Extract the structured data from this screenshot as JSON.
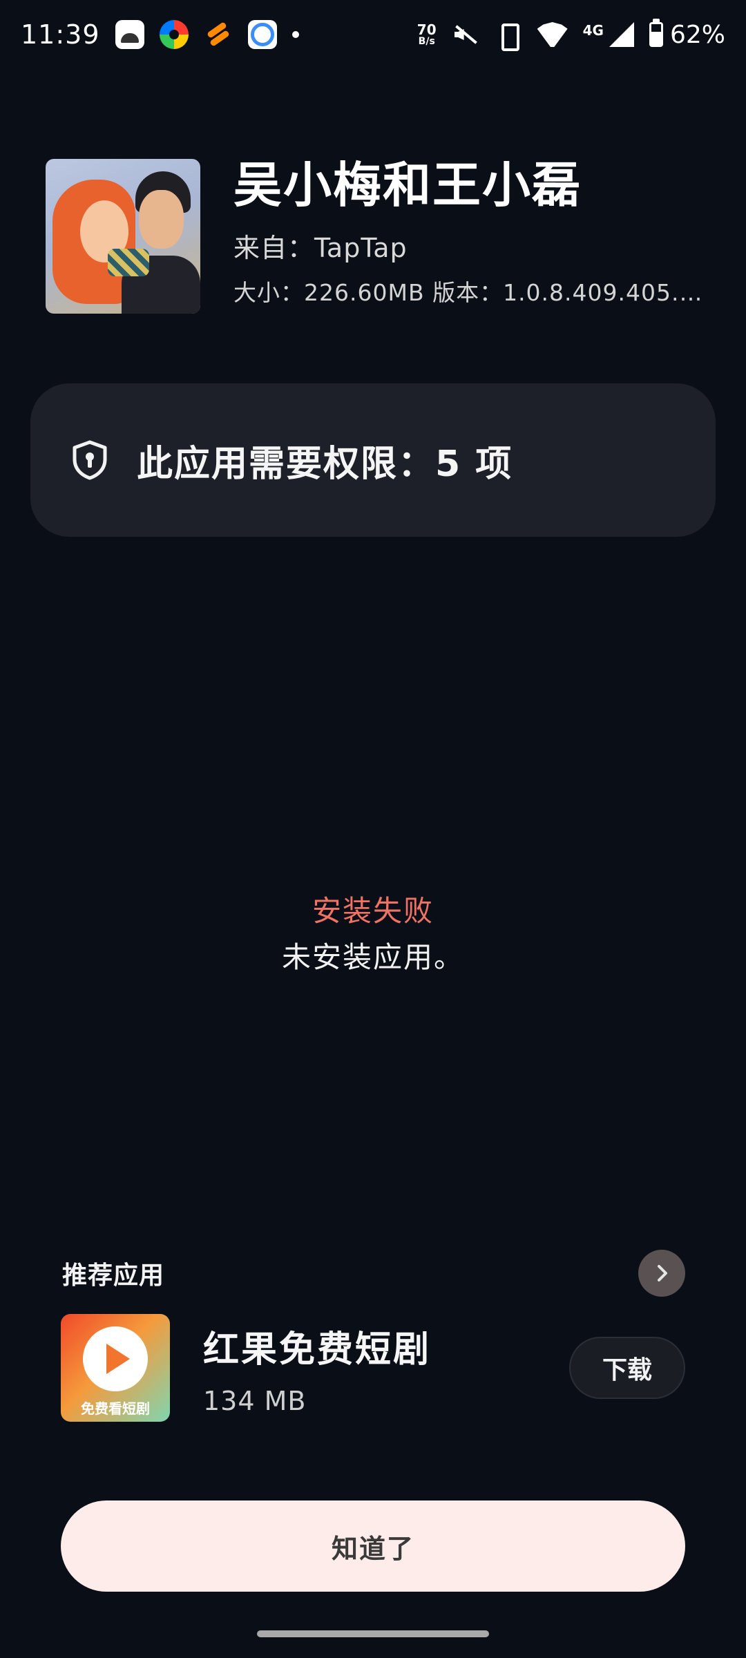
{
  "status_bar": {
    "time": "11:39",
    "net_speed_value": "70",
    "net_speed_unit": "B/s",
    "network_type": "4G",
    "battery_percent": "62%",
    "notification_icons": [
      "mi-icon",
      "colorful-app-icon",
      "orange-app-icon",
      "browser-icon"
    ]
  },
  "app": {
    "name": "吴小梅和王小磊",
    "source": "来自：TapTap",
    "size_version": "大小：226.60MB 版本：1.0.8.409.405.1…"
  },
  "permissions": {
    "text": "此应用需要权限：5 项",
    "icon": "shield-lock-icon"
  },
  "install": {
    "title": "安装失败",
    "message": "未安装应用。",
    "title_color": "#f07265"
  },
  "recommended": {
    "title": "推荐应用",
    "items": [
      {
        "name": "红果免费短剧",
        "size": "134 MB",
        "icon_caption": "免费看短剧",
        "action": "下载"
      }
    ]
  },
  "confirm": {
    "label": "知道了"
  }
}
